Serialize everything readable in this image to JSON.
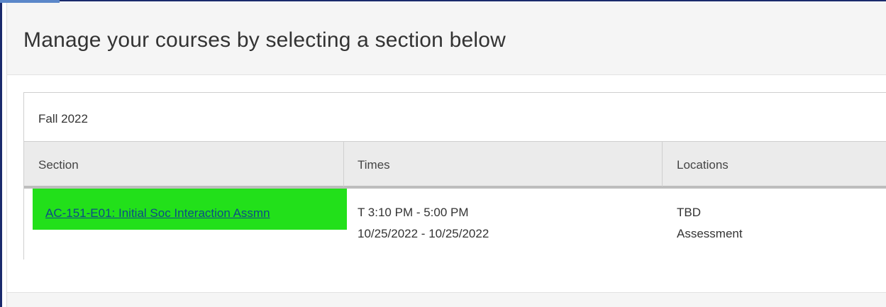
{
  "page": {
    "title": "Manage your courses by selecting a section below"
  },
  "term": {
    "name": "Fall 2022"
  },
  "table": {
    "headers": {
      "section": "Section",
      "times": "Times",
      "locations": "Locations"
    },
    "rows": [
      {
        "section": "AC-151-E01: Initial Soc Interaction Assmn",
        "times_line1": "T 3:10 PM - 5:00 PM",
        "times_line2": "10/25/2022 - 10/25/2022",
        "location_line1": "TBD",
        "location_line2": "Assessment"
      }
    ]
  },
  "colors": {
    "highlight": "#22e01a",
    "link": "#0d4a85",
    "window_border": "#1a2a6c"
  }
}
